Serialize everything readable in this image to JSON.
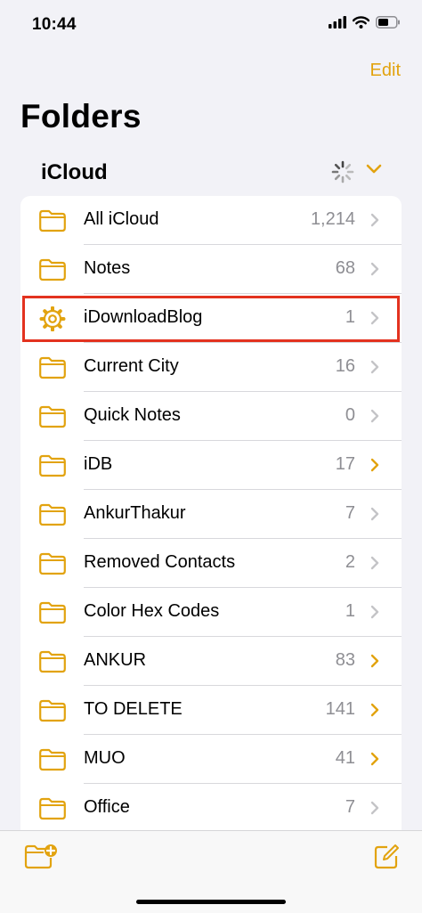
{
  "status_bar": {
    "time": "10:44"
  },
  "nav": {
    "edit_label": "Edit",
    "title": "Folders"
  },
  "section": {
    "title": "iCloud"
  },
  "colors": {
    "accent": "#e2a30f",
    "highlight": "#e3321f",
    "count": "#8e8e93"
  },
  "folders": [
    {
      "name": "All iCloud",
      "count": "1,214",
      "icon": "folder-icon",
      "chevron": "gray"
    },
    {
      "name": "Notes",
      "count": "68",
      "icon": "folder-icon",
      "chevron": "gray"
    },
    {
      "name": "iDownloadBlog",
      "count": "1",
      "icon": "gear-icon",
      "chevron": "gray",
      "highlighted": true
    },
    {
      "name": "Current City",
      "count": "16",
      "icon": "folder-icon",
      "chevron": "gray"
    },
    {
      "name": "Quick Notes",
      "count": "0",
      "icon": "folder-icon",
      "chevron": "gray"
    },
    {
      "name": "iDB",
      "count": "17",
      "icon": "folder-icon",
      "chevron": "accent"
    },
    {
      "name": "AnkurThakur",
      "count": "7",
      "icon": "folder-icon",
      "chevron": "gray"
    },
    {
      "name": "Removed Contacts",
      "count": "2",
      "icon": "folder-icon",
      "chevron": "gray"
    },
    {
      "name": "Color Hex Codes",
      "count": "1",
      "icon": "folder-icon",
      "chevron": "gray"
    },
    {
      "name": "ANKUR",
      "count": "83",
      "icon": "folder-icon",
      "chevron": "accent"
    },
    {
      "name": "TO DELETE",
      "count": "141",
      "icon": "folder-icon",
      "chevron": "accent"
    },
    {
      "name": "MUO",
      "count": "41",
      "icon": "folder-icon",
      "chevron": "accent"
    },
    {
      "name": "Office",
      "count": "7",
      "icon": "folder-icon",
      "chevron": "gray"
    }
  ],
  "toolbar": {
    "left_icon": "new-folder-icon",
    "right_icon": "compose-icon"
  }
}
